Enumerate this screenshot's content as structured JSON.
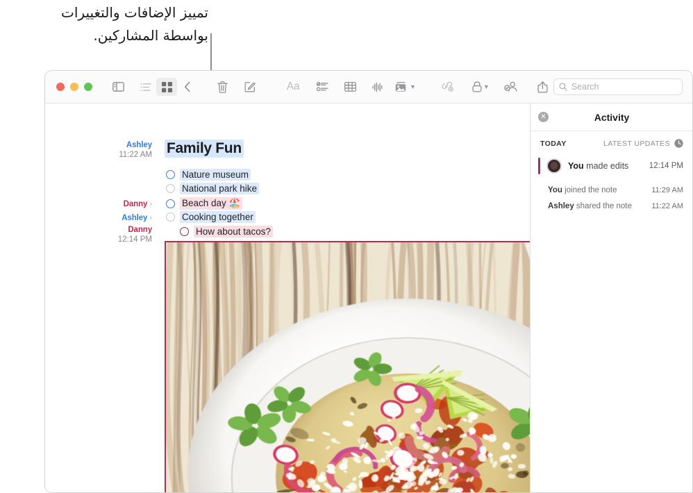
{
  "callout": {
    "text": "تمييز الإضافات والتغييرات\nبواسطة المشاركين."
  },
  "toolbar": {
    "sidebar_toggle": "sidebar-toggle",
    "list_view": "list-view",
    "gallery_view": "gallery-view",
    "back": "back",
    "delete": "delete",
    "compose": "compose",
    "format": "Aa",
    "checklist": "checklist",
    "table": "table",
    "audio": "audio",
    "media": "media",
    "link": "link",
    "lock": "lock",
    "collaborate": "collaborate",
    "share": "share"
  },
  "search": {
    "placeholder": "Search",
    "value": ""
  },
  "note": {
    "title": "Family Fun",
    "title_author": "Ashley",
    "title_time": "11:22 AM",
    "checklist": [
      {
        "text": "Nature museum",
        "author": "",
        "time": "",
        "circle": "blue",
        "highlight": "blue",
        "indent": 0
      },
      {
        "text": "National park hike",
        "author": "",
        "time": "",
        "circle": "gray",
        "highlight": "blue",
        "indent": 0
      },
      {
        "text": "Beach day 🏖️",
        "author": "Danny",
        "time": "",
        "circle": "blue",
        "highlight": "rose",
        "indent": 0
      },
      {
        "text": "Cooking together",
        "author": "Ashley",
        "time": "",
        "circle": "gray",
        "highlight": "blue",
        "indent": 0
      },
      {
        "text": "How about tacos?",
        "author": "Danny",
        "time": "12:14 PM",
        "circle": "maroon",
        "highlight": "pink",
        "indent": 1
      }
    ],
    "attachment": {
      "name": "taco-photo",
      "edit_border_color": "#b42b52"
    }
  },
  "activity": {
    "title": "Activity",
    "close_label": "✕",
    "today_label": "TODAY",
    "latest_updates_label": "LATEST UPDATES",
    "featured": {
      "name": "You",
      "action": " made edits",
      "time": "12:14 PM",
      "bar_color": "#b42b52"
    },
    "entries": [
      {
        "name": "You",
        "action": " joined the note",
        "time": "11:29 AM"
      },
      {
        "name": "Ashley",
        "action": " shared the note",
        "time": "11:22 AM"
      }
    ]
  },
  "colors": {
    "ashley": "#2f7ddb",
    "danny": "#bb2a4f",
    "accent_edit": "#b42b52"
  }
}
